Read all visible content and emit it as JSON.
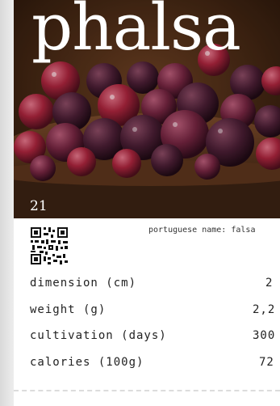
{
  "card": {
    "title": "phalsa",
    "number": "21",
    "portuguese_label": "portuguese name:",
    "portuguese_value": "falsa",
    "specs": [
      {
        "label": "dimension (cm)",
        "value": "2"
      },
      {
        "label": "weight (g)",
        "value": "2,2"
      },
      {
        "label": "cultivation (days)",
        "value": "300"
      },
      {
        "label": "calories (100g)",
        "value": "72"
      }
    ]
  },
  "icons": {
    "qr": "qr-code-icon"
  },
  "colors": {
    "card_background": "#ffffff",
    "title_color": "#ffffff",
    "berry_dark": "#3d1a2a",
    "berry_red": "#9b1b30",
    "bowl_brown": "#4a2a18"
  }
}
